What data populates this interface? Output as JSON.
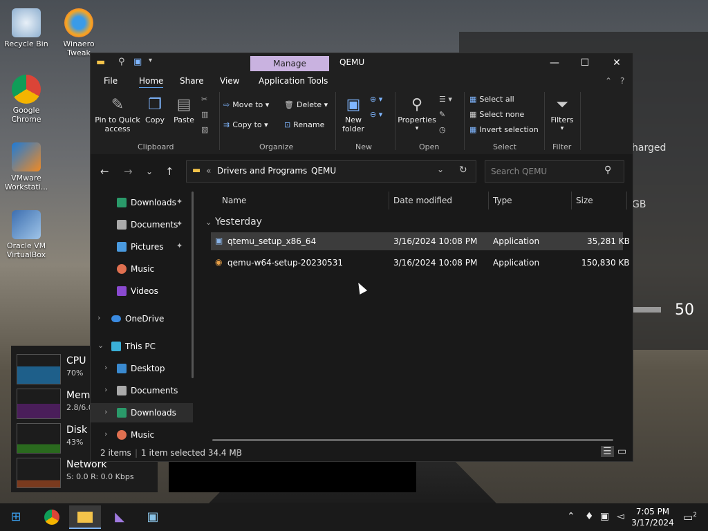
{
  "desktop": {
    "icons": [
      {
        "label": "Recycle Bin"
      },
      {
        "label": "Winaero Tweak"
      },
      {
        "label": "Google Chrome"
      },
      {
        "label": "VMware Workstati..."
      },
      {
        "label": "Oracle VM VirtualBox"
      }
    ],
    "bg_window": {
      "text1": "harged",
      "text2": "GB",
      "number": "50"
    }
  },
  "perf_widget": {
    "cpu": {
      "label": "CPU",
      "value": "70%"
    },
    "memory": {
      "label": "Mem",
      "value": "2.8/6.0"
    },
    "disk": {
      "label": "Disk",
      "value": "43%"
    },
    "network": {
      "label": "Network",
      "value": "S: 0.0  R: 0.0 Kbps"
    }
  },
  "explorer": {
    "title": "QEMU",
    "manage_tab": "Manage",
    "menu": {
      "file": "File",
      "home": "Home",
      "share": "Share",
      "view": "View",
      "app_tools": "Application Tools"
    },
    "ribbon": {
      "pin": "Pin to Quick access",
      "copy": "Copy",
      "paste": "Paste",
      "clipboard": "Clipboard",
      "move_to": "Move to",
      "copy_to": "Copy to",
      "delete": "Delete",
      "rename": "Rename",
      "organize": "Organize",
      "new_folder": "New folder",
      "new": "New",
      "properties": "Properties",
      "open": "Open",
      "select_all": "Select all",
      "select_none": "Select none",
      "invert_selection": "Invert selection",
      "select": "Select",
      "filters": "Filters",
      "filter": "Filter"
    },
    "address": {
      "prefix": "«",
      "crumb1": "Drivers and Programs",
      "crumb2": "QEMU"
    },
    "search_placeholder": "Search QEMU",
    "sidebar": [
      {
        "label": "Downloads",
        "pinned": true
      },
      {
        "label": "Documents",
        "pinned": true
      },
      {
        "label": "Pictures",
        "pinned": true
      },
      {
        "label": "Music"
      },
      {
        "label": "Videos"
      },
      {
        "label": "OneDrive"
      },
      {
        "label": "This PC"
      },
      {
        "label": "Desktop"
      },
      {
        "label": "Documents"
      },
      {
        "label": "Downloads"
      },
      {
        "label": "Music"
      }
    ],
    "columns": {
      "name": "Name",
      "date": "Date modified",
      "type": "Type",
      "size": "Size"
    },
    "group": "Yesterday",
    "files": [
      {
        "name": "qtemu_setup_x86_64",
        "date": "3/16/2024 10:08 PM",
        "type": "Application",
        "size": "35,281 KB"
      },
      {
        "name": "qemu-w64-setup-20230531",
        "date": "3/16/2024 10:08 PM",
        "type": "Application",
        "size": "150,830 KB"
      }
    ],
    "status": {
      "items": "2 items",
      "selected": "1 item selected  34.4 MB"
    }
  },
  "taskbar": {
    "time": "7:05 PM",
    "date": "3/17/2024",
    "notif_count": "2"
  },
  "colors": {
    "accent": "#7fb6ff",
    "manage": "#c9b2e0",
    "window_bg": "#191919"
  }
}
